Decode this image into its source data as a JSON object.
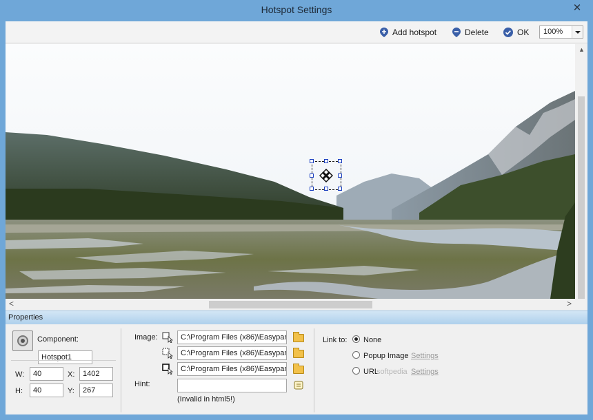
{
  "window": {
    "title": "Hotspot Settings",
    "close_glyph": "✕"
  },
  "toolbar": {
    "add_hotspot": "Add hotspot",
    "delete": "Delete",
    "ok": "OK",
    "zoom": "100%"
  },
  "scroll": {
    "left": "<",
    "right": ">"
  },
  "properties": {
    "header": "Properties",
    "component_label": "Component:",
    "component_value": "Hotspot1",
    "w_label": "W:",
    "w_value": "40",
    "h_label": "H:",
    "h_value": "40",
    "x_label": "X:",
    "x_value": "1402",
    "y_label": "Y:",
    "y_value": "267",
    "image_label": "Image:",
    "image_paths": [
      "C:\\Program Files (x86)\\Easypan",
      "C:\\Program Files (x86)\\Easypan",
      "C:\\Program Files (x86)\\Easypan"
    ],
    "hint_label": "Hint:",
    "hint_value": "",
    "hint_note": "(Invalid in html5!)",
    "link_label": "Link to:",
    "link_none": "None",
    "link_popup": "Popup Image",
    "link_url": "URL",
    "settings_link": "Settings",
    "watermark": "softpedia"
  },
  "colors": {
    "title_bar": "#6fa7d8",
    "accent_blue": "#1a3fbf",
    "sky": "#f6f8fa"
  }
}
